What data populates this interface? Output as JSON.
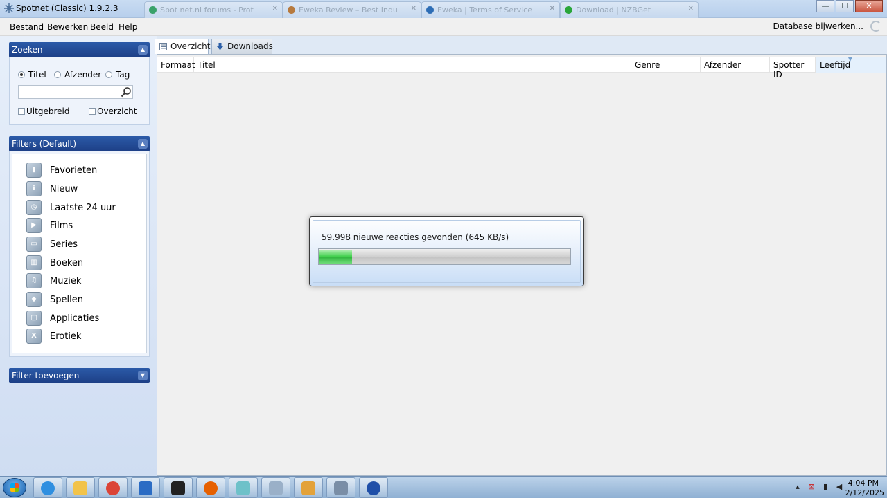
{
  "window": {
    "title": "Spotnet (Classic) 1.9.2.3",
    "background_tabs": [
      {
        "label": "Spot net.nl forums - Prot"
      },
      {
        "label": "Eweka Review – Best Indu"
      },
      {
        "label": "Eweka | Terms of Service"
      },
      {
        "label": "Download | NZBGet"
      }
    ],
    "controls": {
      "minimize": "—",
      "maximize": "☐",
      "close": "✕"
    }
  },
  "menu": {
    "items": [
      "Bestand",
      "Bewerken",
      "Beeld",
      "Help"
    ],
    "database_update": "Database bijwerken..."
  },
  "search_panel": {
    "header": "Zoeken",
    "radios": [
      {
        "label": "Titel",
        "selected": true
      },
      {
        "label": "Afzender",
        "selected": false
      },
      {
        "label": "Tag",
        "selected": false
      }
    ],
    "search_value": "",
    "checkboxes": [
      {
        "label": "Uitgebreid",
        "checked": false
      },
      {
        "label": "Overzicht",
        "checked": false
      }
    ]
  },
  "filters_panel": {
    "header": "Filters (Default)",
    "items": [
      {
        "label": "Favorieten",
        "icon": "bookmark-icon"
      },
      {
        "label": "Nieuw",
        "icon": "info-icon"
      },
      {
        "label": "Laatste 24 uur",
        "icon": "clock-icon"
      },
      {
        "label": "Films",
        "icon": "film-icon"
      },
      {
        "label": "Series",
        "icon": "tv-icon"
      },
      {
        "label": "Boeken",
        "icon": "book-icon"
      },
      {
        "label": "Muziek",
        "icon": "music-icon"
      },
      {
        "label": "Spellen",
        "icon": "gamepad-icon"
      },
      {
        "label": "Applicaties",
        "icon": "application-icon"
      },
      {
        "label": "Erotiek",
        "icon": "x-icon"
      }
    ]
  },
  "add_filter_panel": {
    "header": "Filter toevoegen"
  },
  "tabs": [
    {
      "label": "Overzicht",
      "active": true
    },
    {
      "label": "Downloads",
      "active": false
    }
  ],
  "grid": {
    "columns": [
      "Formaat",
      "Titel",
      "Genre",
      "Afzender",
      "Spotter ID",
      "Leeftijd"
    ],
    "sorted_column": "Leeftijd"
  },
  "progress_dialog": {
    "message": "59.998 nieuwe reacties gevonden  (645 KB/s)",
    "progress_fraction": 0.13,
    "fill_color": "#3fcf4b"
  },
  "taskbar": {
    "apps": [
      {
        "name": "internet-explorer",
        "color": "#2f8fe0"
      },
      {
        "name": "file-explorer",
        "color": "#f2c34a"
      },
      {
        "name": "chrome",
        "color": "#db4437"
      },
      {
        "name": "app-plane",
        "color": "#2b6cc4"
      },
      {
        "name": "app-audio",
        "color": "#222222"
      },
      {
        "name": "firefox",
        "color": "#e66000"
      },
      {
        "name": "app-notes",
        "color": "#6ec1c9"
      },
      {
        "name": "calculator",
        "color": "#9ab0c8"
      },
      {
        "name": "app-lion",
        "color": "#e3a23a"
      },
      {
        "name": "spotnet",
        "color": "#7a8ea6"
      },
      {
        "name": "help",
        "color": "#1f4fa8"
      }
    ],
    "time": "4:04 PM",
    "date": "2/12/2025"
  }
}
